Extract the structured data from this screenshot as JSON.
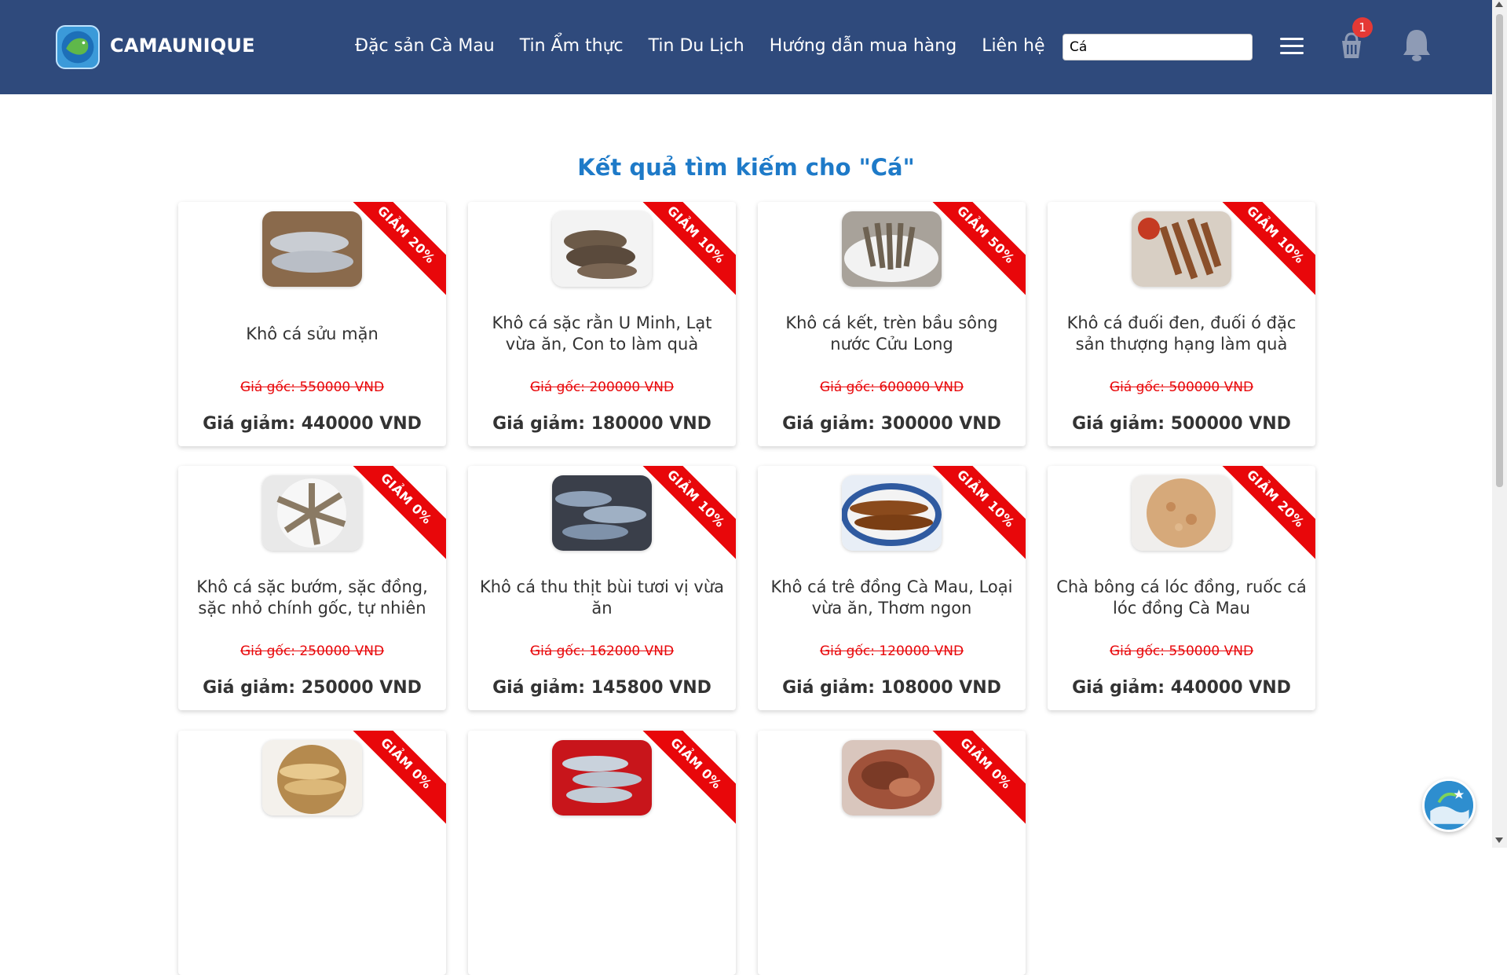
{
  "header": {
    "brand": "CAMAUNIQUE",
    "nav": [
      "Đặc sản Cà Mau",
      "Tin Ẩm thực",
      "Tin Du Lịch",
      "Hướng dẫn mua hàng",
      "Liên hệ"
    ],
    "search_value": "Cá",
    "cart_count": "1"
  },
  "results": {
    "title": "Kết quả tìm kiếm cho \"Cá\""
  },
  "products": [
    {
      "name": "Khô cá sửu mặn",
      "discount": "GIẢM 20%",
      "original": "Giá gốc: 550000 VND",
      "sale": "Giá giảm: 440000 VND"
    },
    {
      "name": "Khô cá sặc rằn U Minh, Lạt vừa ăn, Con to làm quà",
      "discount": "GIẢM 10%",
      "original": "Giá gốc: 200000 VND",
      "sale": "Giá giảm: 180000 VND"
    },
    {
      "name": "Khô cá kết, trèn bầu sông nước Cửu Long",
      "discount": "GIẢM 50%",
      "original": "Giá gốc: 600000 VND",
      "sale": "Giá giảm: 300000 VND"
    },
    {
      "name": "Khô cá đuối đen, đuối ó đặc sản thượng hạng làm quà",
      "discount": "GIẢM 10%",
      "original": "Giá gốc: 500000 VND",
      "sale": "Giá giảm: 500000 VND"
    },
    {
      "name": "Khô cá sặc bướm, sặc đồng, sặc nhỏ chính gốc, tự nhiên",
      "discount": "GIẢM 0%",
      "original": "Giá gốc: 250000 VND",
      "sale": "Giá giảm: 250000 VND"
    },
    {
      "name": "Khô cá thu thịt bùi tươi vị vừa ăn",
      "discount": "GIẢM 10%",
      "original": "Giá gốc: 162000 VND",
      "sale": "Giá giảm: 145800 VND"
    },
    {
      "name": "Khô cá trê đồng Cà Mau, Loại vừa ăn, Thơm ngon",
      "discount": "GIẢM 10%",
      "original": "Giá gốc: 120000 VND",
      "sale": "Giá giảm: 108000 VND"
    },
    {
      "name": "Chà bông cá lóc đồng, ruốc cá lóc đồng Cà Mau",
      "discount": "GIẢM 20%",
      "original": "Giá gốc: 550000 VND",
      "sale": "Giá giảm: 440000 VND"
    },
    {
      "name": "",
      "discount": "GIẢM 0%",
      "original": "",
      "sale": ""
    },
    {
      "name": "",
      "discount": "GIẢM 0%",
      "original": "",
      "sale": ""
    },
    {
      "name": "",
      "discount": "GIẢM 0%",
      "original": "",
      "sale": ""
    }
  ],
  "colors": {
    "header_bg": "#2f4a7c",
    "title": "#1e7ac8",
    "ribbon": "#e8070a",
    "original_price": "#e8070a",
    "sale_price": "#333333"
  }
}
